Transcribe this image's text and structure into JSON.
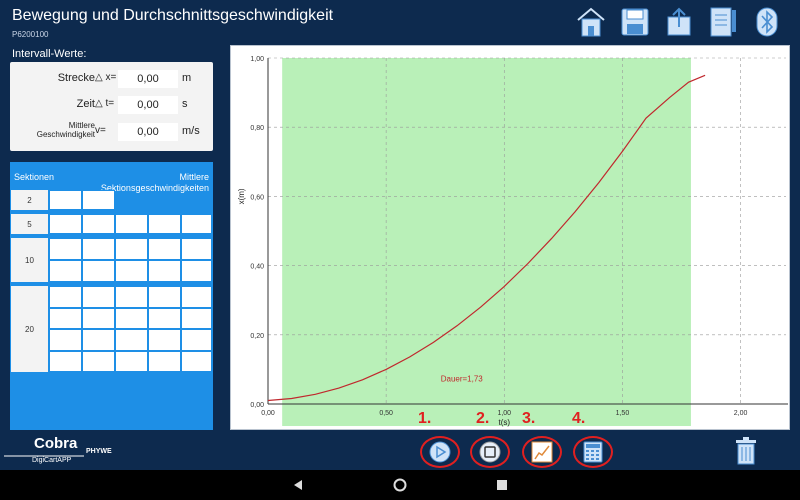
{
  "header": {
    "title": "Bewegung und Durchschnittsgeschwindigkeit",
    "subtitle": "P6200100",
    "icons": [
      "home-icon",
      "save-icon",
      "share-icon",
      "notebook-icon",
      "bluetooth-icon"
    ]
  },
  "interval": {
    "heading": "Intervall-Werte:",
    "rows": [
      {
        "label": "Strecke",
        "symbol": "△ x=",
        "value": "0,00",
        "unit": "m"
      },
      {
        "label": "Zeit",
        "symbol": "△ t=",
        "value": "0,00",
        "unit": "s"
      },
      {
        "label": "Mittlere\nGeschwindigkeit",
        "symbol": "v=",
        "value": "0,00",
        "unit": "m/s"
      }
    ]
  },
  "sections": {
    "heading_left": "Sektionen",
    "heading_right": "Mittlere\nSektionsgeschwindigkeiten",
    "labels": [
      "2",
      "5",
      "10",
      "20"
    ]
  },
  "chart_data": {
    "type": "line",
    "xlabel": "t(s)",
    "ylabel": "x(m)",
    "xlim": [
      0,
      2.15
    ],
    "ylim": [
      0,
      1.0
    ],
    "xticks": [
      "0,00",
      "0,50",
      "1,00",
      "1,50",
      "2,00"
    ],
    "yticks": [
      "0,00",
      "0,20",
      "0,40",
      "0,60",
      "0,80",
      "1,00"
    ],
    "xtick_values": [
      0,
      0.5,
      1.0,
      1.5,
      2.0
    ],
    "ytick_values": [
      0,
      0.2,
      0.4,
      0.6,
      0.8,
      1.0
    ],
    "grid": true,
    "highlight_range": [
      0.06,
      1.79
    ],
    "annotation": "Dauer=1,73",
    "series": [
      {
        "color": "#c0282d",
        "x": [
          0.0,
          0.1,
          0.2,
          0.3,
          0.4,
          0.5,
          0.6,
          0.7,
          0.8,
          0.9,
          1.0,
          1.1,
          1.2,
          1.3,
          1.4,
          1.5,
          1.6,
          1.7,
          1.78,
          1.85
        ],
        "y": [
          0.01,
          0.016,
          0.028,
          0.046,
          0.07,
          0.1,
          0.136,
          0.178,
          0.226,
          0.28,
          0.34,
          0.406,
          0.478,
          0.556,
          0.64,
          0.73,
          0.826,
          0.886,
          0.93,
          0.95
        ]
      }
    ]
  },
  "toolbar": {
    "logo_main": "Cobra",
    "logo_sub": "DigiCartAPP",
    "logo_brand": "PHYWE",
    "step_numbers": [
      "1.",
      "2.",
      "3.",
      "4."
    ],
    "tools": [
      "play-icon",
      "stop-icon",
      "chart-icon",
      "calculator-icon"
    ],
    "trash": "trash-icon"
  },
  "colors": {
    "background": "#0d2a4e",
    "accent": "#1e8fe6",
    "highlight": "#b9f0b8",
    "curve": "#c0282d",
    "marker": "#e02020"
  }
}
